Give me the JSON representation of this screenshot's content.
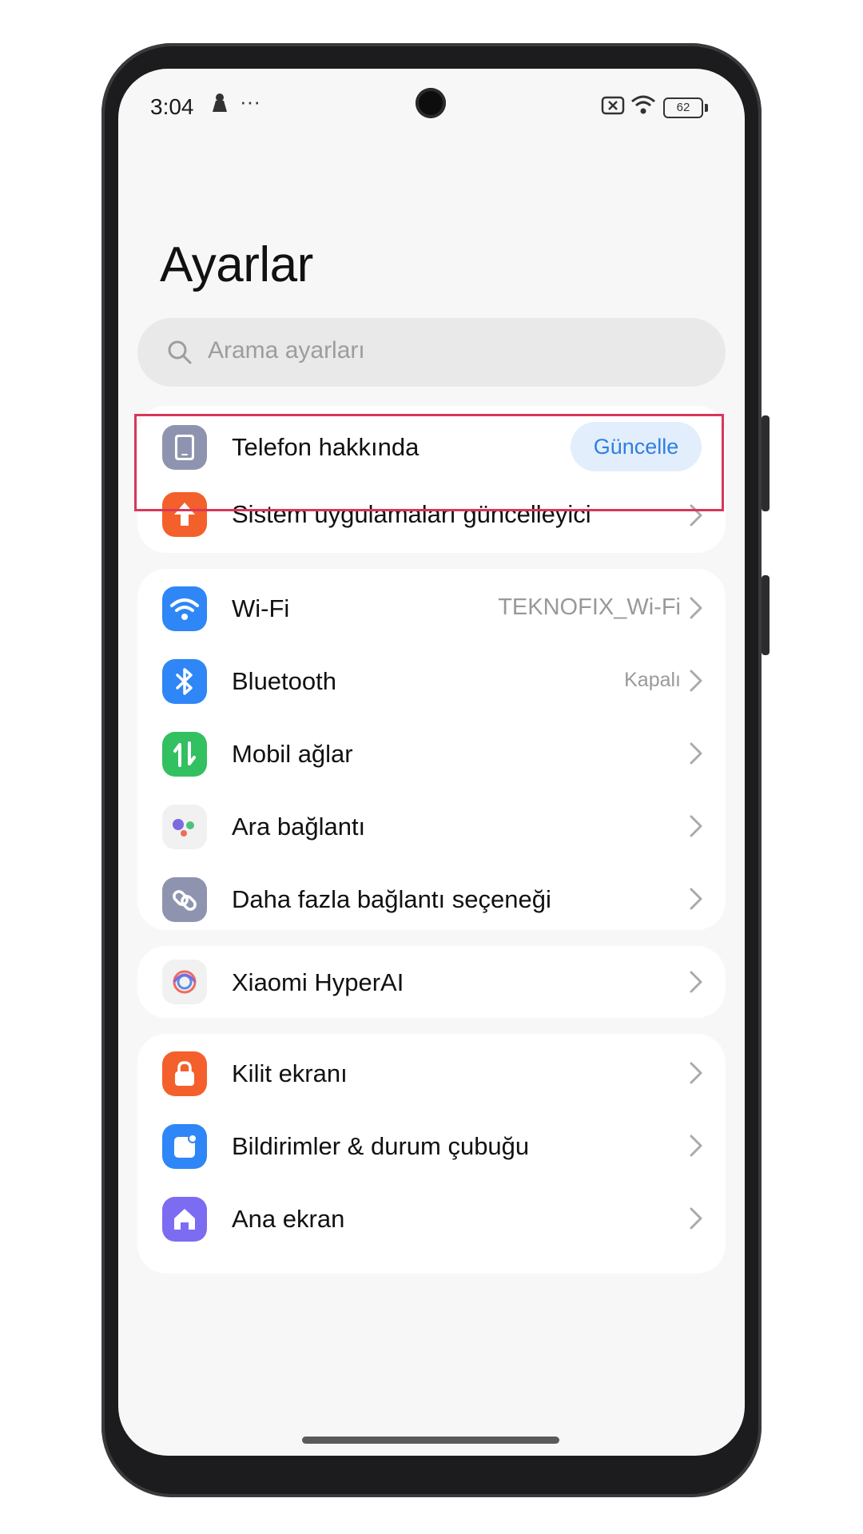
{
  "status_bar": {
    "time": "3:04",
    "dots": "···",
    "battery": "62"
  },
  "title": "Ayarlar",
  "search": {
    "placeholder": "Arama ayarları"
  },
  "group1": [
    {
      "label": "Telefon hakkında",
      "badge": "Güncelle",
      "icon": "phone-icon",
      "color": "#8e94b0"
    },
    {
      "label": "Sistem uygulamaları güncelleyici",
      "icon": "arrow-up-icon",
      "color": "#f4602b"
    }
  ],
  "group2": [
    {
      "label": "Wi-Fi",
      "value": "TEKNOFIX_Wi-Fi",
      "icon": "wifi-icon",
      "color": "#2f86f6"
    },
    {
      "label": "Bluetooth",
      "value": "Kapalı",
      "icon": "bluetooth-icon",
      "color": "#2f86f6"
    },
    {
      "label": "Mobil ağlar",
      "icon": "mobile-data-icon",
      "color": "#33c060"
    },
    {
      "label": "Ara bağlantı",
      "icon": "dots-icon",
      "color": "#f1f1f1"
    },
    {
      "label": "Daha fazla bağlantı seçeneği",
      "icon": "link-icon",
      "color": "#8e94b0"
    }
  ],
  "group3": [
    {
      "label": "Xiaomi HyperAI",
      "icon": "hyperai-icon",
      "color": "#f1f1f1"
    }
  ],
  "group4": [
    {
      "label": "Kilit ekranı",
      "icon": "lock-icon",
      "color": "#f4602b"
    },
    {
      "label": "Bildirimler & durum çubuğu",
      "icon": "notification-icon",
      "color": "#2f86f6"
    },
    {
      "label": "Ana ekran",
      "icon": "home-icon",
      "color": "#7c6cf2"
    }
  ]
}
